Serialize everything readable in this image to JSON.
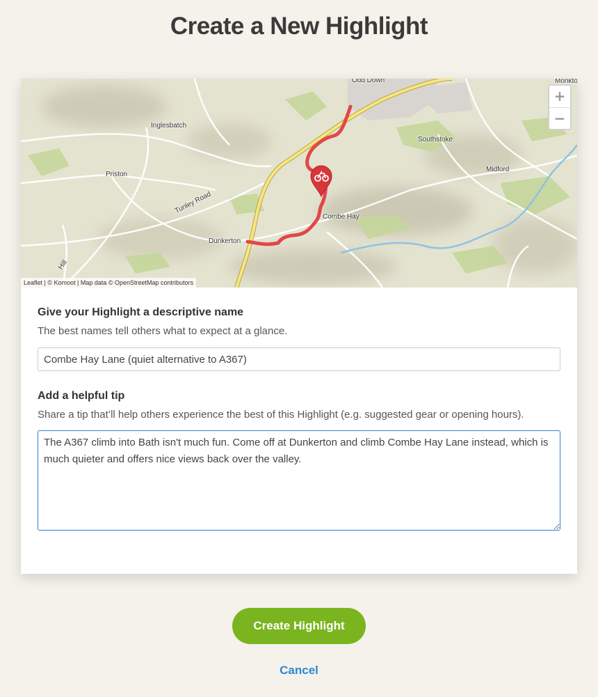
{
  "page": {
    "title": "Create a New Highlight"
  },
  "map": {
    "places": [
      "Odd Down",
      "Inglesbatch",
      "Southstoke",
      "Priston",
      "Midford",
      "Tunley Road",
      "Combe Hay",
      "Dunkerton",
      "Hill",
      "Monkton"
    ],
    "attribution": "Leaflet | © Komoot | Map data © OpenStreetMap contributors",
    "zoom_in": "+",
    "zoom_out": "−",
    "route_color": "#e04848",
    "marker_icon": "bicycle-icon"
  },
  "name_section": {
    "label": "Give your Highlight a descriptive name",
    "help": "The best names tell others what to expect at a glance.",
    "value": "Combe Hay Lane (quiet alternative to A367)"
  },
  "tip_section": {
    "label": "Add a helpful tip",
    "help": "Share a tip that’ll help others experience the best of this Highlight (e.g. suggested gear or opening hours).",
    "value": "The A367 climb into Bath isn't much fun. Come off at Dunkerton and climb Combe Hay Lane instead, which is much quieter and offers nice views back over the valley."
  },
  "actions": {
    "create_label": "Create Highlight",
    "cancel_label": "Cancel"
  },
  "colors": {
    "accent_green": "#7ab51f",
    "link_blue": "#2a88d8",
    "background": "#f4f2ea"
  }
}
